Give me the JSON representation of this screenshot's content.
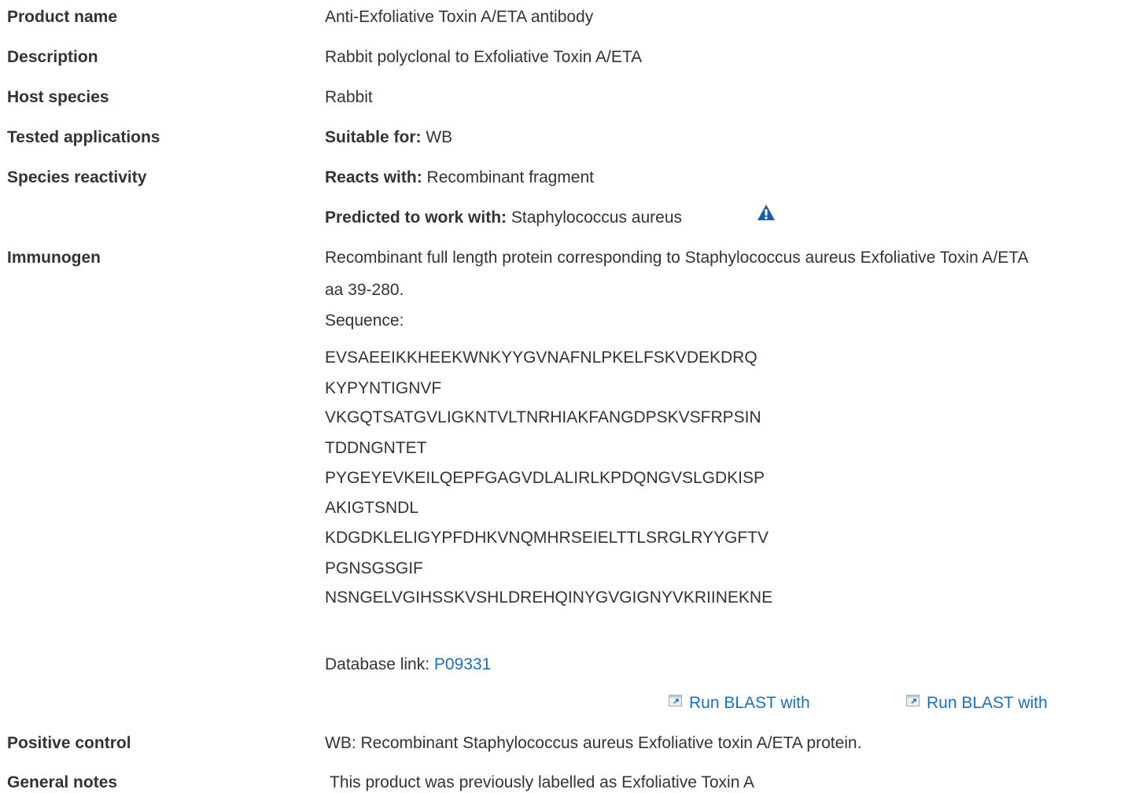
{
  "rows": {
    "product_name": {
      "label": "Product name",
      "value": "Anti-Exfoliative Toxin A/ETA antibody"
    },
    "description": {
      "label": "Description",
      "value": "Rabbit polyclonal to Exfoliative Toxin A/ETA"
    },
    "host_species": {
      "label": "Host species",
      "value": "Rabbit"
    },
    "tested_applications": {
      "label": "Tested applications",
      "prefix": "Suitable for:",
      "value": "WB"
    },
    "species_reactivity": {
      "label": "Species reactivity",
      "reacts_prefix": "Reacts with:",
      "reacts_value": "Recombinant fragment",
      "predicted_prefix": "Predicted to work with:",
      "predicted_value": "Staphylococcus aureus",
      "warning_icon": "warning-triangle-icon",
      "warning_color": "#1a5fa8"
    },
    "immunogen": {
      "label": "Immunogen",
      "line1": "Recombinant full length protein corresponding to Staphylococcus aureus Exfoliative Toxin A/ETA",
      "line2": "aa 39-280.",
      "sequence_label": "Sequence:",
      "sequence_lines": [
        "EVSAEEIKKHEEKWNKYYGVNAFNLPKELFSKVDEKDRQ",
        "KYPYNTIGNVF",
        "VKGQTSATGVLIGKNTVLTNRHIAKFANGDPSKVSFRPSIN",
        "TDDNGNTET",
        "PYGEYEVKEILQEPFGAGVDLALIRLKPDQNGVSLGDKISP",
        "AKIGTSNDL",
        "KDGDKLELIGYPFDHKVNQMHRSEIELTTLSRGLRYYGFTV",
        "PGNSGSGIF",
        "NSNGELVGIHSSKVSHLDREHQINYGVGIGNYVKRIINEKNE"
      ],
      "database_prefix": "Database link:",
      "database_link": "P09331",
      "blast_1": "Run BLAST with",
      "blast_2": "Run BLAST with",
      "blast_icon": "external-window-icon"
    },
    "positive_control": {
      "label": "Positive control",
      "value": "WB: Recombinant Staphylococcus aureus Exfoliative toxin A/ETA protein."
    },
    "general_notes": {
      "label": "General notes",
      "value": "This product was previously labelled as Exfoliative Toxin A"
    }
  },
  "colors": {
    "text": "#333333",
    "link": "#1a6fc4"
  }
}
